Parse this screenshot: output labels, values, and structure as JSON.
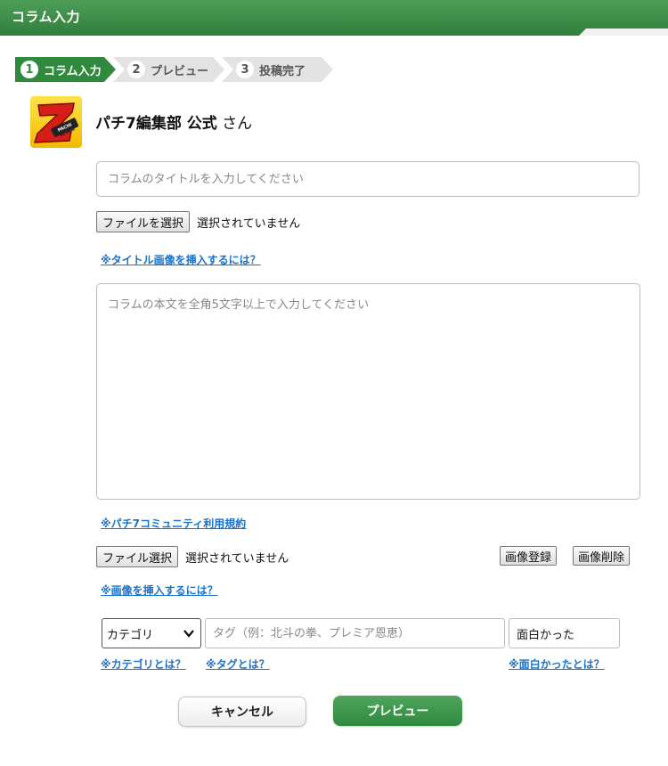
{
  "header": {
    "title": "コラム入力"
  },
  "steps": [
    {
      "num": "1",
      "label": "コラム入力"
    },
    {
      "num": "2",
      "label": "プレビュー"
    },
    {
      "num": "3",
      "label": "投稿完了"
    }
  ],
  "profile": {
    "name": "パチ7編集部 公式",
    "suffix": " さん",
    "avatar_icon": "pachi-seven-logo",
    "avatar_logo_text": "PACHI SEVEN"
  },
  "column_title": {
    "placeholder": "コラムのタイトルを入力してください",
    "value": ""
  },
  "title_file": {
    "button_label": "ファイルを選択",
    "status": "選択されていません"
  },
  "links": {
    "title_image_help": "※タイトル画像を挿入するには？",
    "terms": "※パチ7コミュニティ利用規約",
    "image_help": "※画像を挿入するには？",
    "category_help": "※カテゴリとは？",
    "tag_help": "※タグとは？",
    "fun_help": "※面白かったとは？"
  },
  "body": {
    "placeholder": "コラムの本文を全角5文字以上で入力してください",
    "value": ""
  },
  "image_file": {
    "button_label": "ファイル選択",
    "status": "選択されていません",
    "register_label": "画像登録",
    "delete_label": "画像削除"
  },
  "category": {
    "selected": "カテゴリ"
  },
  "tag": {
    "placeholder": "タグ（例：北斗の拳、プレミア恩恵）",
    "value": ""
  },
  "fun": {
    "value": "面白かった"
  },
  "actions": {
    "cancel_label": "キャンセル",
    "preview_label": "プレビュー"
  },
  "colors": {
    "brand_green": "#2f8a3e",
    "link_blue": "#1a73c9"
  }
}
